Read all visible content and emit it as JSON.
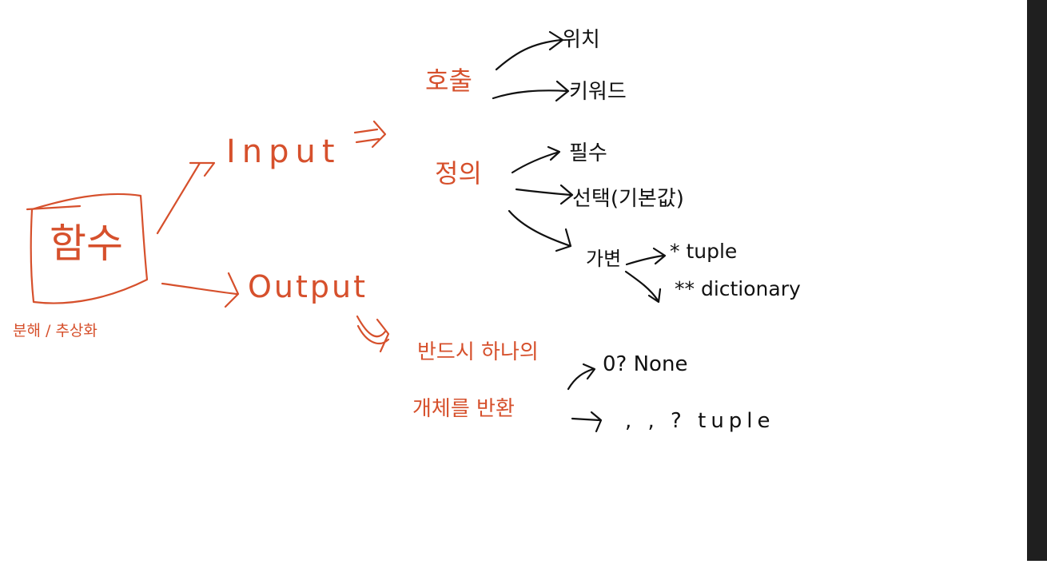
{
  "colors": {
    "ink_orange": "#d6502c",
    "ink_black": "#111111",
    "background": "#ffffff",
    "side_strip": "#1f1f1f"
  },
  "root": {
    "label": "함수",
    "caption": "분해 / 추상화"
  },
  "input": {
    "label": "Input",
    "call": {
      "label": "호출",
      "children": [
        "위치",
        "키워드"
      ]
    },
    "define": {
      "label": "정의",
      "children": [
        "필수",
        "선택(기본값)",
        "가변"
      ],
      "variadic_children": [
        "* tuple",
        "** dictionary"
      ]
    }
  },
  "output": {
    "label": "Output",
    "line1": "반드시 하나의",
    "line2": "개체를 반환",
    "results": [
      "0? None",
      ", , ? tuple"
    ]
  }
}
